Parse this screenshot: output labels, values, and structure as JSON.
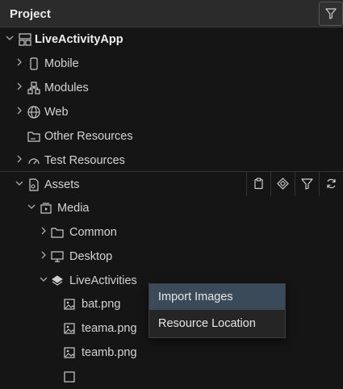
{
  "panel": {
    "title": "Project"
  },
  "tree": {
    "root": "LiveActivityApp",
    "mobile": "Mobile",
    "modules": "Modules",
    "web": "Web",
    "other_resources": "Other Resources",
    "test_resources": "Test Resources",
    "assets": "Assets",
    "media": "Media",
    "common": "Common",
    "desktop": "Desktop",
    "live_activities": "LiveActivities",
    "files": [
      "bat.png",
      "teama.png",
      "teamb.png"
    ]
  },
  "context_menu": {
    "items": [
      "Import Images",
      "Resource Location"
    ]
  }
}
